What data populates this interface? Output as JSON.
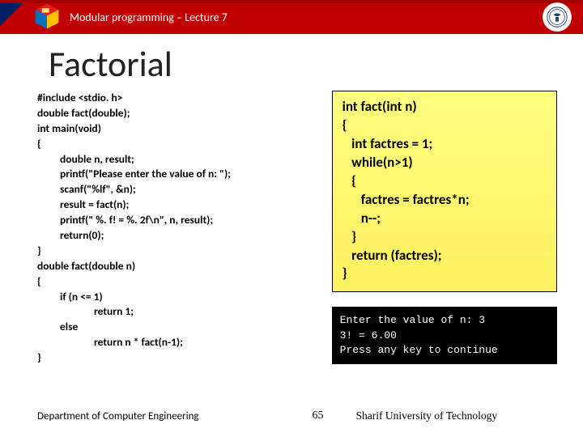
{
  "header": {
    "title": "Modular programming – Lecture 7"
  },
  "title": "Factorial",
  "left_code": {
    "l1": "#include <stdio. h>",
    "l2a_kw": "double ",
    "l2b": "fact(",
    "l2c_kw": "double",
    "l2d": ");",
    "l3a_kw": "int ",
    "l3b": "main(",
    "l3c_kw": "void",
    "l3d": ")",
    "l4": "{",
    "l5a_kw": "double ",
    "l5b": "n, result;",
    "l6": "printf(\"Please enter the value of n: \");",
    "l7": "scanf(\"%lf\", &n);",
    "l8": "",
    "l9": "result = fact(n);",
    "l10": "printf(\" %. f! = %. 2f\\n\", n, result);",
    "l11a_kw": "return",
    "l11b": "(0);",
    "l12": "}",
    "l13a_kw": "double ",
    "l13b": "fact(",
    "l13c_kw": "double ",
    "l13d": "n)",
    "l14": "{",
    "l15a_kw": "if ",
    "l15b": "(n <= 1)",
    "l16a_kw": "return ",
    "l16b": "1;",
    "l17_kw": "else",
    "l18a_kw": "return ",
    "l18b": "n * fact(n-1);",
    "l19": "}"
  },
  "right_code": "int fact(int n)\n{\n   int factres = 1;\n   while(n>1)\n   {\n      factres = factres*n;\n      n--;\n   }\n   return (factres);\n}",
  "console": "Enter the value of n: 3\n3! = 6.00\nPress any key to continue",
  "footer": {
    "left": "Department of Computer Engineering",
    "center": "65",
    "right": "Sharif University of Technology"
  }
}
